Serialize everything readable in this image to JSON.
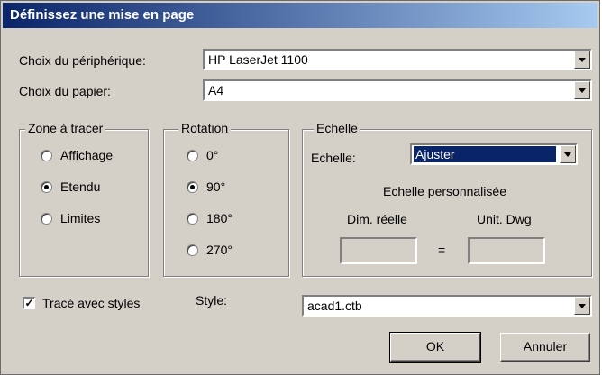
{
  "window": {
    "title": "Définissez une mise en page"
  },
  "device": {
    "label": "Choix du périphérique:",
    "value": "HP LaserJet 1100"
  },
  "paper": {
    "label": "Choix du papier:",
    "value": "A4"
  },
  "zone": {
    "title": "Zone à tracer",
    "options": [
      {
        "label": "Affichage",
        "checked": false
      },
      {
        "label": "Etendu",
        "checked": true
      },
      {
        "label": "Limites",
        "checked": false
      }
    ]
  },
  "rotation": {
    "title": "Rotation",
    "options": [
      {
        "label": "0°",
        "checked": false
      },
      {
        "label": "90°",
        "checked": true
      },
      {
        "label": "180°",
        "checked": false
      },
      {
        "label": "270°",
        "checked": false
      }
    ]
  },
  "scale": {
    "title": "Echelle",
    "label": "Echelle:",
    "value": "Ajuster",
    "custom_label": "Echelle personnalisée",
    "real_dim_label": "Dim. réelle",
    "dwg_unit_label": "Unit. Dwg",
    "equals": "=",
    "real_dim_value": "",
    "dwg_unit_value": ""
  },
  "styles": {
    "checkbox_label": "Tracé avec styles",
    "checked": true,
    "check_mark": "✓",
    "style_label": "Style:",
    "style_value": "acad1.ctb"
  },
  "buttons": {
    "ok": "OK",
    "cancel": "Annuler"
  }
}
